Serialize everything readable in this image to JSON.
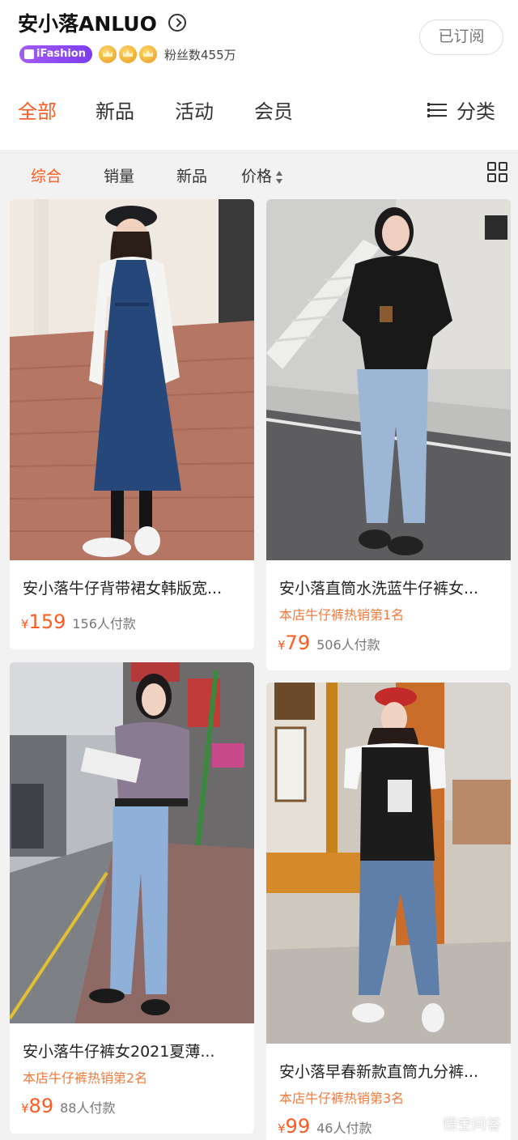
{
  "shop": {
    "name": "安小落ANLUO",
    "badge": "iFashion",
    "fans": "粉丝数455万",
    "subscribe_label": "已订阅"
  },
  "tabs": [
    "全部",
    "新品",
    "活动",
    "会员"
  ],
  "category_label": "分类",
  "sort": [
    "综合",
    "销量",
    "新品",
    "价格"
  ],
  "products": [
    {
      "title": "安小落牛仔背带裙女韩版宽...",
      "rank": "",
      "price_symbol": "¥",
      "price": "159",
      "paid": "156人付款"
    },
    {
      "title": "安小落直筒水洗蓝牛仔裤女...",
      "rank": "本店牛仔裤热销第1名",
      "price_symbol": "¥",
      "price": "79",
      "paid": "506人付款"
    },
    {
      "title": "安小落牛仔裤女2021夏薄...",
      "rank": "本店牛仔裤热销第2名",
      "price_symbol": "¥",
      "price": "89",
      "paid": "88人付款"
    },
    {
      "title": "安小落早春新款直筒九分裤...",
      "rank": "本店牛仔裤热销第3名",
      "price_symbol": "¥",
      "price": "99",
      "paid": "46人付款"
    }
  ],
  "watermark": "悟空问答",
  "colors": {
    "accent": "#ff5a1f",
    "rank": "#f07a3c",
    "badge": "#8b47f2"
  }
}
